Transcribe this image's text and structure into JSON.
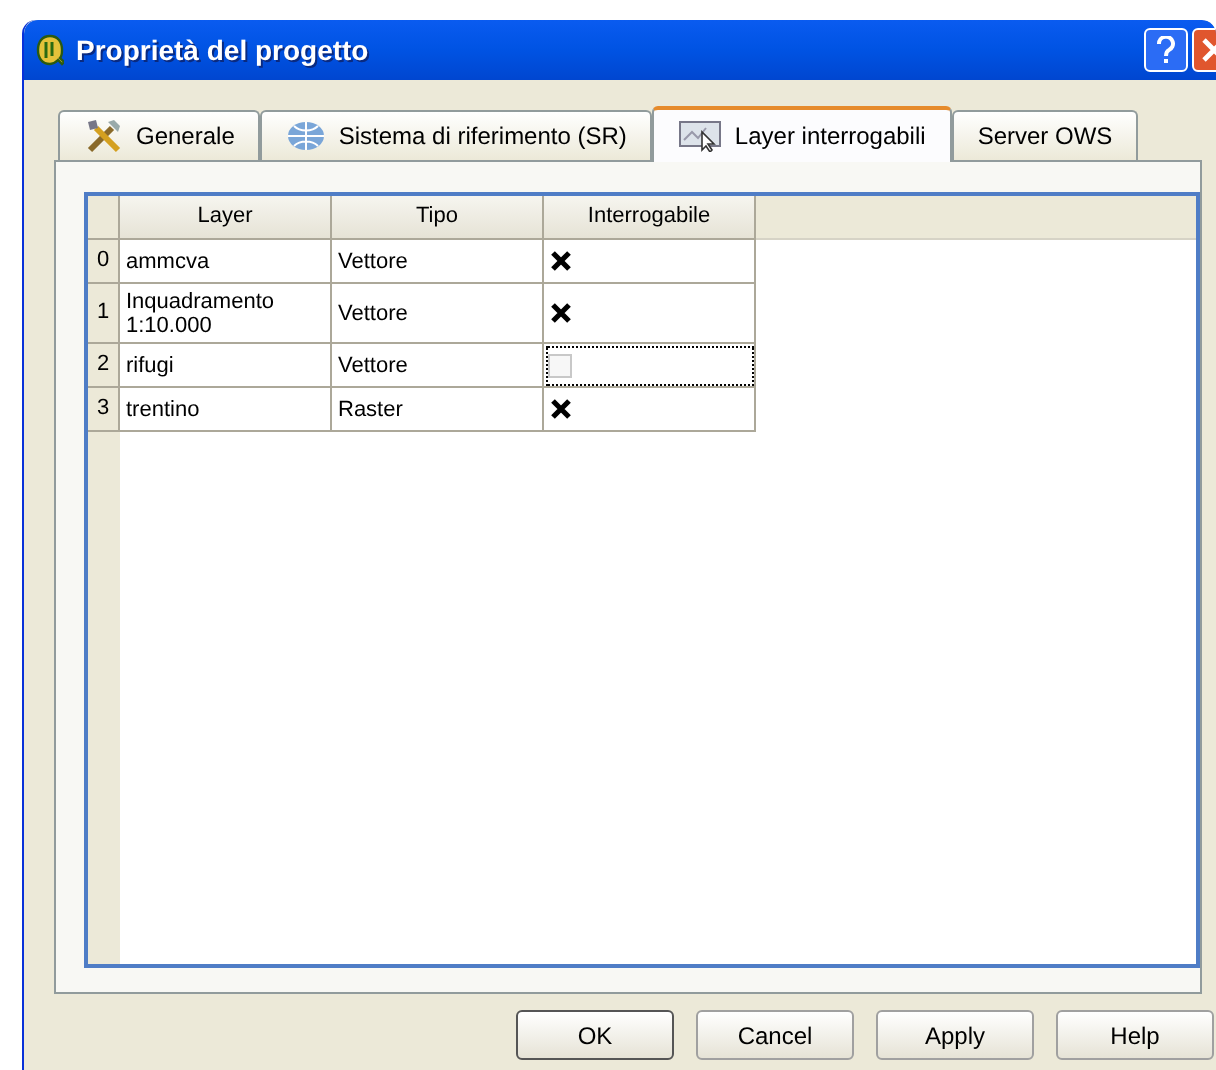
{
  "window": {
    "title": "Proprietà del progetto"
  },
  "tabs": [
    {
      "label": "Generale",
      "kind": "tools",
      "selected": false
    },
    {
      "label": "Sistema di riferimento (SR)",
      "kind": "globe",
      "selected": false
    },
    {
      "label": "Layer interrogabili",
      "kind": "map",
      "selected": true
    },
    {
      "label": "Server OWS",
      "selected": false
    }
  ],
  "table": {
    "columns": [
      "Layer",
      "Tipo",
      "Interrogabile"
    ],
    "rows": [
      {
        "index": "0",
        "layer": "ammcva",
        "type": "Vettore",
        "checked": true,
        "focused": false
      },
      {
        "index": "1",
        "layer": "Inquadramento 1:10.000",
        "type": "Vettore",
        "checked": true,
        "focused": false
      },
      {
        "index": "2",
        "layer": "rifugi",
        "type": "Vettore",
        "checked": false,
        "focused": true
      },
      {
        "index": "3",
        "layer": "trentino",
        "type": "Raster",
        "checked": true,
        "focused": false
      }
    ]
  },
  "buttons": [
    "OK",
    "Cancel",
    "Apply",
    "Help"
  ]
}
